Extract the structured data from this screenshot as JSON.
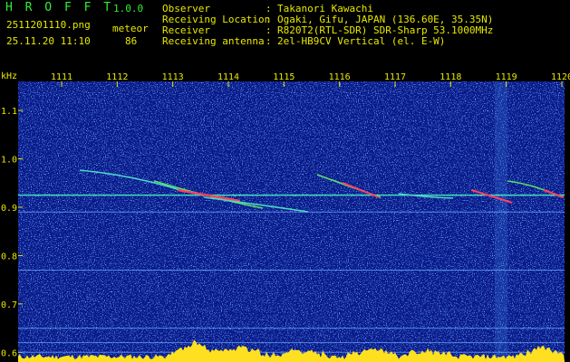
{
  "header": {
    "app_title": "H R O F F T",
    "version": "1.0.0",
    "filename": "2511201110.png",
    "datetime": "25.11.20 11:10",
    "detect_label": "meteor",
    "detect_count": "86",
    "info": [
      {
        "label": "Observer",
        "sep": ":",
        "value": "Takanori Kawachi"
      },
      {
        "label": "Receiving Location",
        "sep": ":",
        "value": "Ogaki, Gifu, JAPAN (136.60E, 35.35N)"
      },
      {
        "label": "Receiver",
        "sep": ":",
        "value": "R820T2(RTL-SDR) SDR-Sharp 53.1000MHz"
      },
      {
        "label": "Receiving antenna",
        "sep": ":",
        "value": "2el-HB9CV Vertical (el. E-W)"
      }
    ]
  },
  "colors": {
    "background": "#000000",
    "text_yellow": "#e8e800",
    "text_green": "#33ee33",
    "spectrum_base": "#0a1a8a"
  },
  "chart_data": {
    "type": "heatmap",
    "ylabel": "kHz",
    "x_ticks": [
      "1111",
      "1112",
      "1113",
      "1114",
      "1115",
      "1116",
      "1117",
      "1118",
      "1119",
      "1120"
    ],
    "y_ticks": [
      "1.1",
      "1.0",
      "0.9",
      "0.8",
      "0.7",
      "0.6"
    ],
    "ylim": [
      0.58,
      1.16
    ],
    "x_range": [
      "11:10",
      "11:21"
    ],
    "carrier_khz": 0.925,
    "horizontal_lines_khz": [
      0.89,
      0.77,
      0.65,
      0.62,
      0.6
    ]
  }
}
